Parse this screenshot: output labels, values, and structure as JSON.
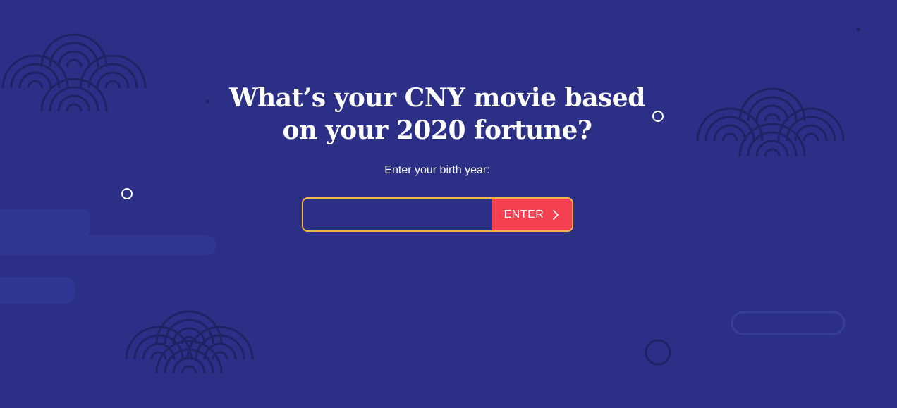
{
  "headline": {
    "line1": "What’s your CNY movie based",
    "line2": "on your 2020 fortune?"
  },
  "prompt": "Enter your birth year:",
  "form": {
    "input_value": "",
    "input_placeholder": "",
    "button_label": "ENTER",
    "button_icon": "chevron-right-icon"
  },
  "colors": {
    "background": "#2b2f86",
    "input_border": "#f6b64a",
    "button": "#f5414f",
    "decoration": "#1f2265"
  }
}
